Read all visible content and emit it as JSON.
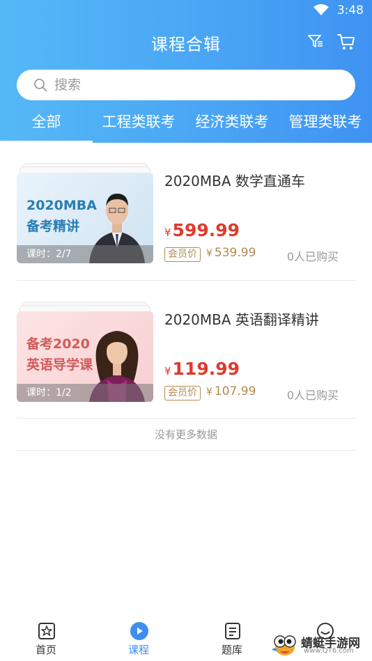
{
  "status_bar": {
    "time": "3:48"
  },
  "header": {
    "title": "课程合辑"
  },
  "search": {
    "placeholder": "搜索"
  },
  "tabs": [
    {
      "label": "全部",
      "active": true
    },
    {
      "label": "工程类联考",
      "active": false
    },
    {
      "label": "经济类联考",
      "active": false
    },
    {
      "label": "管理类联考",
      "active": false
    }
  ],
  "courses": [
    {
      "title": "2020MBA 数学直通车",
      "cover_line1": "2020MBA",
      "cover_line2": "备考精讲",
      "lessons": "课时：2/7",
      "currency": "¥",
      "price": "599.99",
      "member_badge": "会员价",
      "member_price": "539.99",
      "buyers": "0人已购买"
    },
    {
      "title": "2020MBA 英语翻译精讲",
      "cover_line1": "备考2020",
      "cover_line2": "英语导学课",
      "lessons": "课时：1/2",
      "currency": "¥",
      "price": "119.99",
      "member_badge": "会员价",
      "member_price": "107.99",
      "buyers": "0人已购买"
    }
  ],
  "list_footer": "没有更多数据",
  "bottom_nav": [
    {
      "label": "首页",
      "icon": "home-star-icon"
    },
    {
      "label": "课程",
      "icon": "play-circle-icon",
      "active": true
    },
    {
      "label": "题库",
      "icon": "question-bank-icon"
    },
    {
      "label": "",
      "icon": "profile-face-icon"
    }
  ],
  "watermark": {
    "text": "蜻蜓手游网",
    "sub": "www.QT6.com"
  },
  "colors": {
    "header_gradient_start": "#55b8f6",
    "header_gradient_end": "#3f92f2",
    "price": "#e03a2c",
    "member": "#b38a4e",
    "active_tab": "#3d8ef0"
  }
}
